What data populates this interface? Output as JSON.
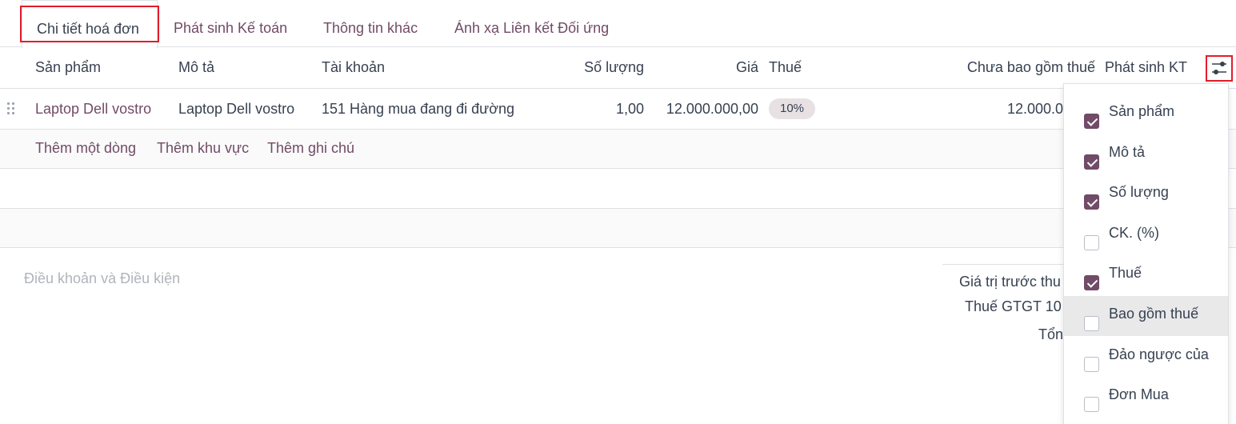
{
  "tabs": [
    {
      "label": "Chi tiết hoá đơn"
    },
    {
      "label": "Phát sinh Kế toán"
    },
    {
      "label": "Thông tin khác"
    },
    {
      "label": "Ánh xạ Liên kết Đối ứng"
    }
  ],
  "columns": {
    "product": "Sản phẩm",
    "description": "Mô tả",
    "account": "Tài khoản",
    "quantity": "Số lượng",
    "price": "Giá",
    "tax": "Thuế",
    "subtotal": "Chưa bao gồm thuế",
    "analytic": "Phát sinh KT"
  },
  "line": {
    "product": "Laptop Dell vostro",
    "description": "Laptop Dell vostro",
    "account": "151 Hàng mua đang đi đường",
    "quantity": "1,00",
    "price": "12.000.000,00",
    "tax": "10%",
    "subtotal": "12.000.0"
  },
  "actions": {
    "add_line": "Thêm một dòng",
    "add_section": "Thêm khu vực",
    "add_note": "Thêm ghi chú"
  },
  "terms_placeholder": "Điều khoản và Điều kiện",
  "totals": {
    "untaxed": "Giá trị trước thu",
    "vat": "Thuế GTGT 10",
    "total": "Tổn"
  },
  "icons": {
    "settings": "sliders-icon",
    "drag": "drag-handle-icon"
  },
  "optional_columns": [
    {
      "label": "Sản phẩm",
      "checked": true
    },
    {
      "label": "Mô tả",
      "checked": true
    },
    {
      "label": "Số lượng",
      "checked": true
    },
    {
      "label": "CK. (%)",
      "checked": false
    },
    {
      "label": "Thuế",
      "checked": true
    },
    {
      "label": "Bao gồm thuế",
      "checked": false
    },
    {
      "label": "Đảo ngược của",
      "checked": false
    },
    {
      "label": "Đơn Mua",
      "checked": false
    }
  ],
  "colors": {
    "accent": "#714B67",
    "highlight_box": "#e11d2a"
  }
}
